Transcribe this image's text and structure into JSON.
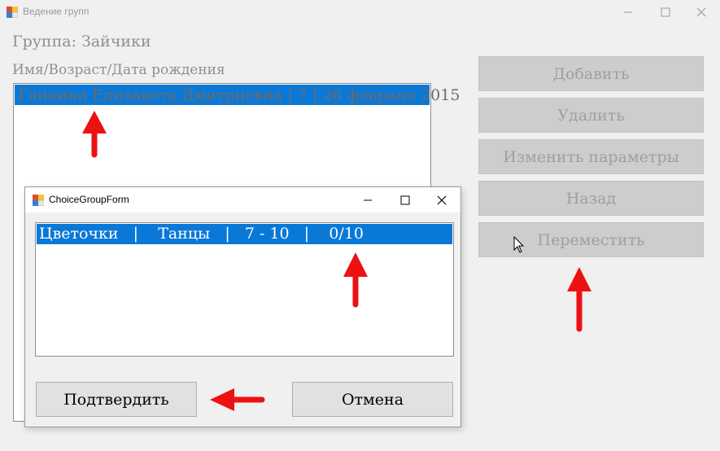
{
  "main_window": {
    "title": "Ведение групп",
    "group_label": "Группа: Зайчики",
    "columns_label": "Имя/Возраст/Дата рождения",
    "students": [
      {
        "text": "Гайкина Елизавета Дмитриевна   |   7   |   26 февраля 2015"
      }
    ],
    "buttons": {
      "add": "Добавить",
      "delete": "Удалить",
      "edit": "Изменить параметры",
      "back": "Назад",
      "move": "Переместить"
    }
  },
  "dialog": {
    "title": "ChoiceGroupForm",
    "groups": [
      {
        "text": "Цветочки   |    Танцы   |   7 - 10   |    0/10"
      }
    ],
    "confirm_label": "Подтвердить",
    "cancel_label": "Отмена"
  },
  "colors": {
    "selection": "#0a78d7",
    "annotation_arrow": "#ee1111"
  }
}
